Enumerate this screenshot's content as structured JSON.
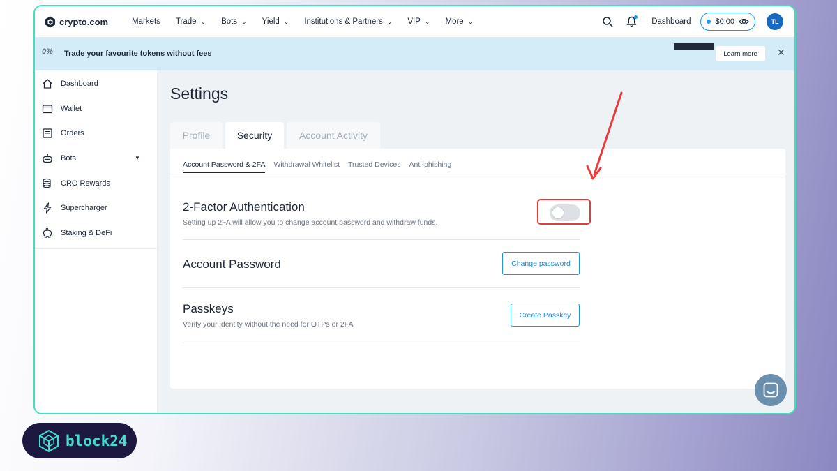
{
  "brand": {
    "name": "crypto.com"
  },
  "nav": {
    "items": [
      {
        "label": "Markets",
        "dropdown": false
      },
      {
        "label": "Trade",
        "dropdown": true
      },
      {
        "label": "Bots",
        "dropdown": true
      },
      {
        "label": "Yield",
        "dropdown": true
      },
      {
        "label": "Institutions & Partners",
        "dropdown": true
      },
      {
        "label": "VIP",
        "dropdown": true
      },
      {
        "label": "More",
        "dropdown": true
      }
    ],
    "dashboard_label": "Dashboard",
    "balance": "$0.00",
    "avatar_initials": "TL"
  },
  "banner": {
    "badge": "0%",
    "text": "Trade your favourite tokens without fees",
    "learn_more": "Learn more"
  },
  "sidebar": {
    "items": [
      {
        "label": "Dashboard",
        "icon": "home-icon"
      },
      {
        "label": "Wallet",
        "icon": "wallet-icon"
      },
      {
        "label": "Orders",
        "icon": "orders-icon"
      },
      {
        "label": "Bots",
        "icon": "bot-icon"
      },
      {
        "label": "CRO Rewards",
        "icon": "coins-icon"
      },
      {
        "label": "Supercharger",
        "icon": "lightning-icon"
      },
      {
        "label": "Staking & DeFi",
        "icon": "piggy-bank-icon"
      }
    ]
  },
  "page": {
    "title": "Settings",
    "tabs": [
      "Profile",
      "Security",
      "Account Activity"
    ],
    "active_tab": "Security",
    "subtabs": [
      "Account Password & 2FA",
      "Withdrawal Whitelist",
      "Trusted Devices",
      "Anti-phishing"
    ],
    "active_subtab": "Account Password & 2FA"
  },
  "security": {
    "two_fa": {
      "title": "2-Factor Authentication",
      "description": "Setting up 2FA will allow you to change account password and withdraw funds.",
      "enabled": false
    },
    "password": {
      "title": "Account Password",
      "button": "Change password"
    },
    "passkeys": {
      "title": "Passkeys",
      "description": "Verify your identity without the need for OTPs or 2FA",
      "button": "Create Passkey"
    }
  },
  "watermark": {
    "text": "block24"
  },
  "colors": {
    "accent": "#1199fa",
    "frame_border": "#3fe0bd",
    "highlight": "#e8393b",
    "banner_bg": "#d4ebf8"
  }
}
